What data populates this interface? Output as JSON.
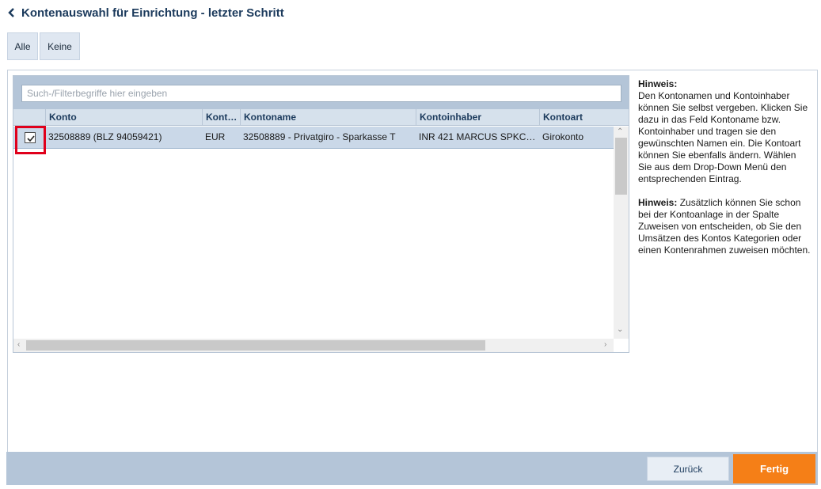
{
  "header": {
    "title": "Kontenauswahl für Einrichtung - letzter Schritt",
    "back_icon": "chevron-left-icon"
  },
  "selection_buttons": {
    "all": "Alle",
    "none": "Keine"
  },
  "search": {
    "placeholder": "Such-/Filterbegriffe hier eingeben",
    "value": ""
  },
  "table": {
    "columns": [
      "Konto",
      "Kont…",
      "Kontoname",
      "Kontoinhaber",
      "Kontoart"
    ],
    "rows": [
      {
        "checked": true,
        "cells": [
          "32508889 (BLZ 94059421)",
          "EUR",
          "32508889 - Privatgiro - Sparkasse T",
          "INR 421 MARCUS SPKC…",
          "Girokonto"
        ]
      }
    ]
  },
  "hints": {
    "label1": "Hinweis:",
    "text1": "Den Kontonamen und Kontoinhaber können Sie selbst vergeben. Klicken Sie dazu in das Feld Kontoname bzw. Kontoinhaber und tragen sie den gewünschten Namen ein. Die Kontoart können Sie ebenfalls ändern. Wählen Sie aus dem Drop-Down Menü den entsprechenden Eintrag.",
    "label2": "Hinweis:",
    "text2": "Zusätzlich können Sie schon bei der Kontoanlage in der Spalte Zuweisen von entscheiden, ob Sie den Umsätzen des Kontos Kategorien oder einen Kontenrahmen zuweisen möchten."
  },
  "footer": {
    "back": "Zurück",
    "finish": "Fertig"
  },
  "colors": {
    "accent": "#f57f17",
    "title": "#1b3a5c",
    "highlight": "#e0001b",
    "toolbar": "#b4c5d8"
  }
}
